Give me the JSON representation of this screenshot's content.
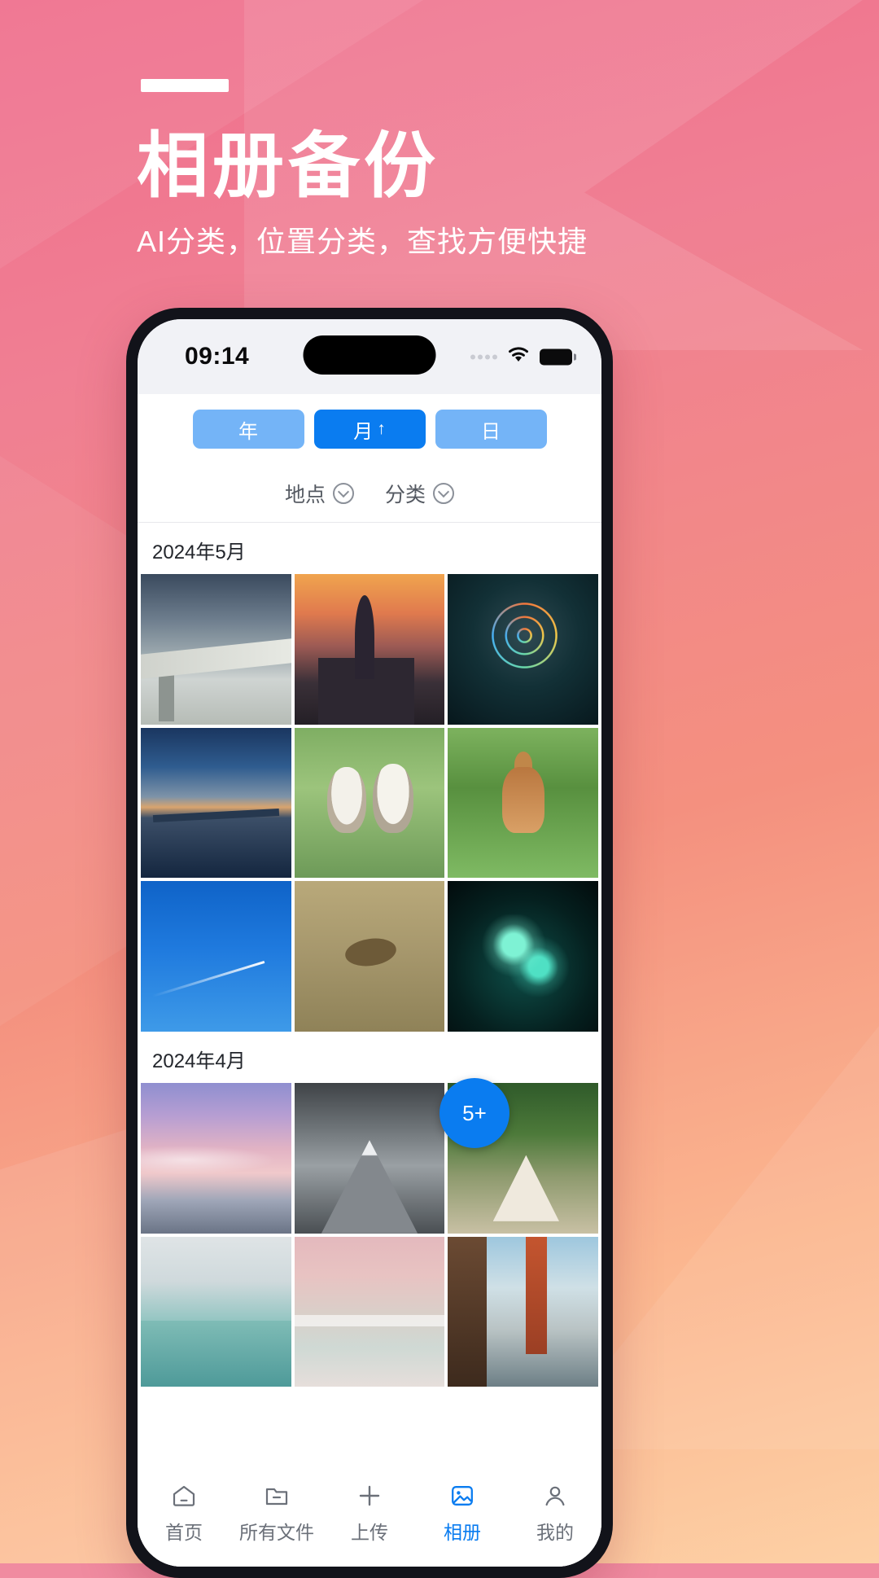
{
  "header": {
    "title": "相册备份",
    "subtitle": "AI分类，位置分类，查找方便快捷"
  },
  "statusbar": {
    "time": "09:14",
    "wifi_icon": "wifi-icon",
    "battery_icon": "battery-icon",
    "signal_icon": "signal-dots-icon"
  },
  "segmented": {
    "items": [
      {
        "label": "年",
        "arrow": "",
        "active": false
      },
      {
        "label": "月",
        "arrow": "↑",
        "active": true
      },
      {
        "label": "日",
        "arrow": "",
        "active": false
      }
    ]
  },
  "filters": [
    {
      "label": "地点",
      "icon": "chevron-down-circle-icon"
    },
    {
      "label": "分类",
      "icon": "chevron-down-circle-icon"
    }
  ],
  "gallery": {
    "sections": [
      {
        "title": "2024年5月",
        "photos": [
          {
            "alt": "snow-mountain-bridge",
            "art": "a-bridge"
          },
          {
            "alt": "church-at-sunset",
            "art": "a-church"
          },
          {
            "alt": "fireworks",
            "art": "a-fire"
          },
          {
            "alt": "pier-at-dusk",
            "art": "a-pier"
          },
          {
            "alt": "two-kookaburras",
            "art": "a-birds"
          },
          {
            "alt": "deer-on-grass",
            "art": "a-deer"
          },
          {
            "alt": "plane-contrail-blue-sky",
            "art": "a-sky"
          },
          {
            "alt": "duck-flying-over-water",
            "art": "a-duck"
          },
          {
            "alt": "glowing-jellyfish",
            "art": "a-jelly"
          }
        ],
        "badge": {
          "label": "5+",
          "on_photo_index": 8
        }
      },
      {
        "title": "2024年4月",
        "photos": [
          {
            "alt": "pastel-sunset-clouds",
            "art": "a-dusk"
          },
          {
            "alt": "black-white-mountain",
            "art": "a-mtn"
          },
          {
            "alt": "teepee-tent-campsite",
            "art": "a-tent"
          },
          {
            "alt": "green-sea-cliff",
            "art": "a-seagreen"
          },
          {
            "alt": "pink-beach-surfers",
            "art": "a-surf"
          },
          {
            "alt": "golden-gate-bridge",
            "art": "a-ggbridge"
          }
        ]
      }
    ]
  },
  "tabbar": {
    "items": [
      {
        "label": "首页",
        "icon": "home-icon",
        "active": false
      },
      {
        "label": "所有文件",
        "icon": "folder-icon",
        "active": false
      },
      {
        "label": "上传",
        "icon": "plus-icon",
        "active": false
      },
      {
        "label": "相册",
        "icon": "photo-icon",
        "active": true
      },
      {
        "label": "我的",
        "icon": "user-icon",
        "active": false
      }
    ]
  },
  "colors": {
    "accent": "#0a7cf0",
    "accent_light": "#74b4f7",
    "bg_pink": "#ef6e8c",
    "bg_peach": "#fdd0a5",
    "text_muted": "#6b7079"
  }
}
